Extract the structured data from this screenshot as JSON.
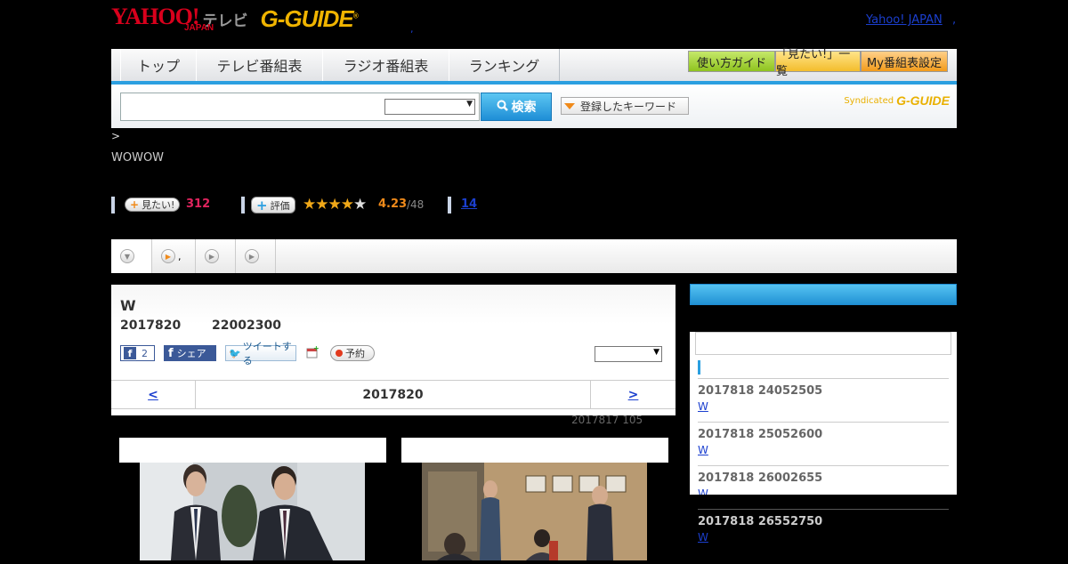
{
  "header": {
    "yahoo_logo": "YAHOO!",
    "yahoo_japan": "JAPAN",
    "tv_label": "テレビ",
    "gguide_logo": "G-GUIDE",
    "dot": ",",
    "yahoo_japan_link": "Yahoo! JAPAN",
    "link_dot": ","
  },
  "nav": {
    "tabs": [
      "トップ",
      "テレビ番組表",
      "ラジオ番組表",
      "ランキング"
    ],
    "buttons": [
      {
        "label": "使い方ガイド",
        "color": "#9ccc1e"
      },
      {
        "label": "「見たい!」一覧",
        "color": "#f6c533"
      },
      {
        "label": "My番組表設定",
        "color": "#f6a623"
      }
    ]
  },
  "search": {
    "input_value": "",
    "select_value": "",
    "button_label": "検索",
    "keyword_button": "登録したキーワード",
    "syndicated": "Syndicated",
    "gguide_mark": "G-GUIDE"
  },
  "breadcrumb": " >",
  "channel": "WOWOW",
  "stats": {
    "want_label": "見たい!",
    "want_count": "312",
    "rate_label": "評価",
    "stars": 4.23,
    "rating": "4.23",
    "rating_count": "/48",
    "review_count": "14"
  },
  "tabs": [
    {
      "label": ""
    },
    {
      "label": ","
    },
    {
      "label": ""
    },
    {
      "label": ""
    }
  ],
  "program": {
    "title": "W",
    "date": "2017820",
    "time": "22002300",
    "fb_count": "2",
    "share_label": "シェア",
    "tweet_label": "ツイートする",
    "reserve_label": "予約",
    "select_value": "",
    "prev": "<",
    "current_date": "2017820",
    "next": ">"
  },
  "updated": "2017817  105",
  "sidebar": {
    "title": "",
    "items": [
      {
        "date": "2017818  24052505",
        "link": "W"
      },
      {
        "date": "2017818  25052600",
        "link": "W"
      },
      {
        "date": "2017818  26002655",
        "link": "W"
      },
      {
        "date": "2017818  26552750",
        "link": "W"
      }
    ]
  },
  "colors": {
    "accent": "#2b9fe0",
    "yahoo_red": "#d8001c",
    "gguide_yellow": "#f0b400",
    "want_count": "#e0245e",
    "rating": "#f08a1a"
  }
}
